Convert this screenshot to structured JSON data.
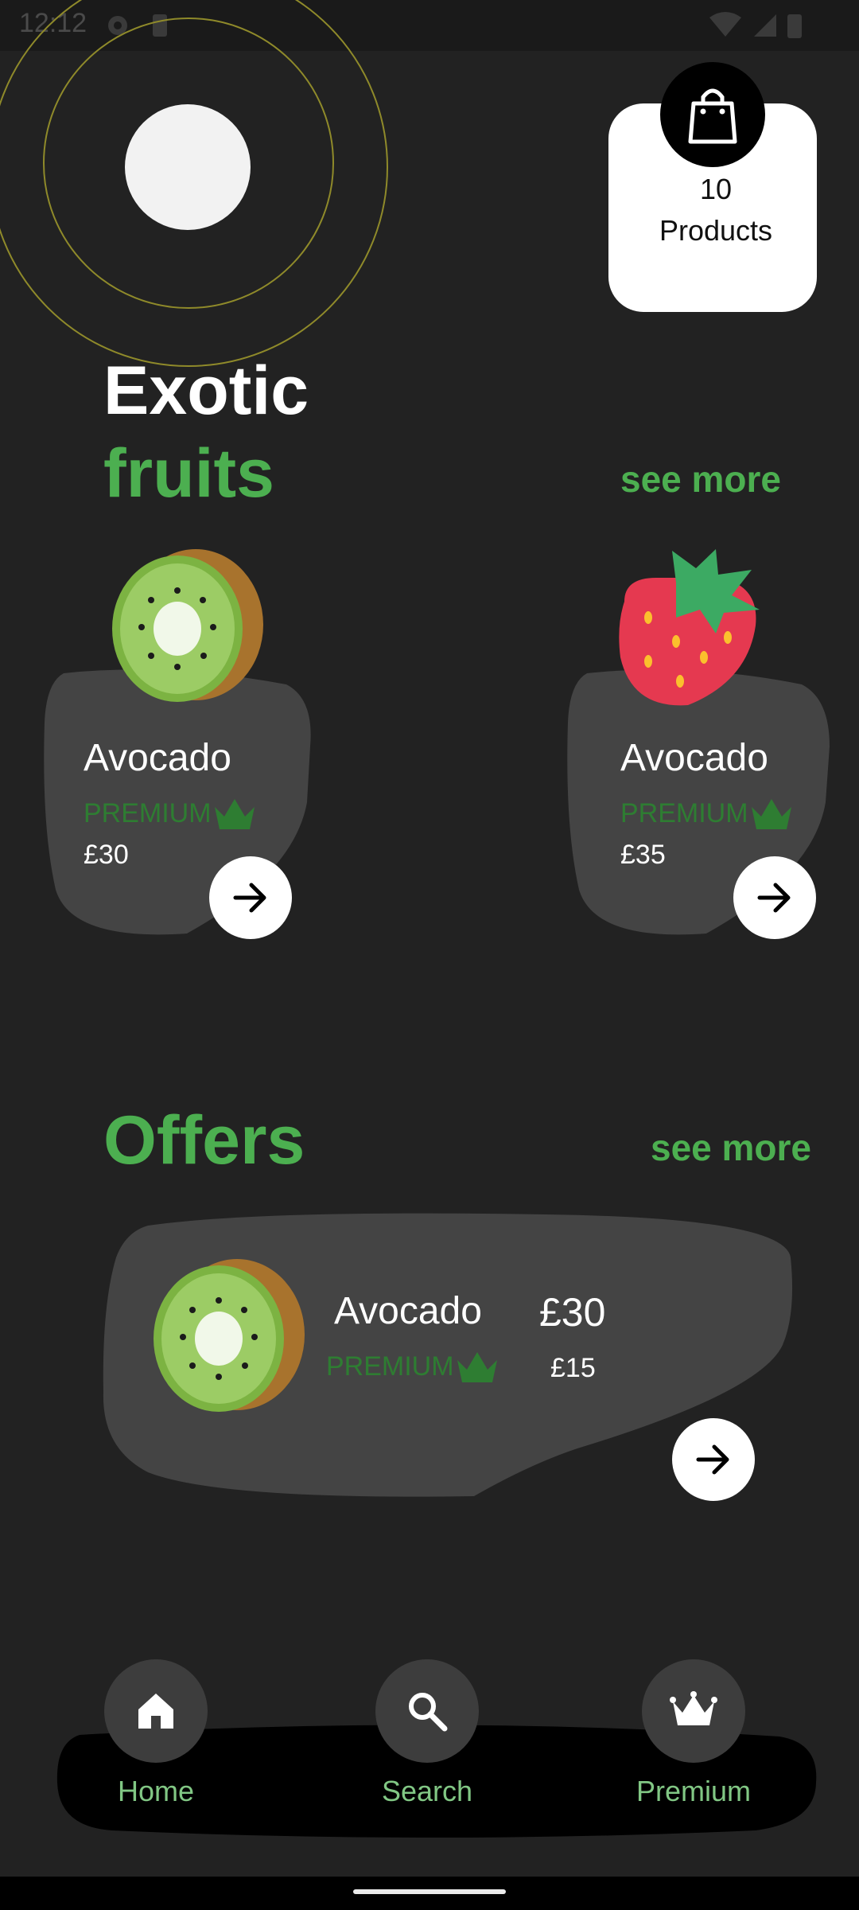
{
  "status_bar": {
    "time": "12:12"
  },
  "cart": {
    "count_label": "10",
    "products_label": "Products"
  },
  "hero": {
    "title_line1": "Exotic",
    "title_line2": "fruits",
    "see_more": "see more"
  },
  "fruit_cards": [
    {
      "name": "Avocado",
      "tier": "PREMIUM",
      "price": "£30",
      "fruit_icon": "kiwi-icon"
    },
    {
      "name": "Avocado",
      "tier": "PREMIUM",
      "price": "£35",
      "fruit_icon": "strawberry-icon"
    }
  ],
  "offers": {
    "title": "Offers",
    "see_more": "see more",
    "item": {
      "name": "Avocado",
      "tier": "PREMIUM",
      "old_price": "£30",
      "new_price": "£15",
      "fruit_icon": "kiwi-icon"
    }
  },
  "bottom_nav": {
    "items": [
      {
        "label": "Home",
        "icon": "home-icon"
      },
      {
        "label": "Search",
        "icon": "search-icon"
      },
      {
        "label": "Premium",
        "icon": "crown-icon"
      }
    ]
  },
  "colors": {
    "accent": "#4caf50",
    "premium": "#2e7d32",
    "card_bg": "#444444",
    "page_bg": "#222222"
  }
}
